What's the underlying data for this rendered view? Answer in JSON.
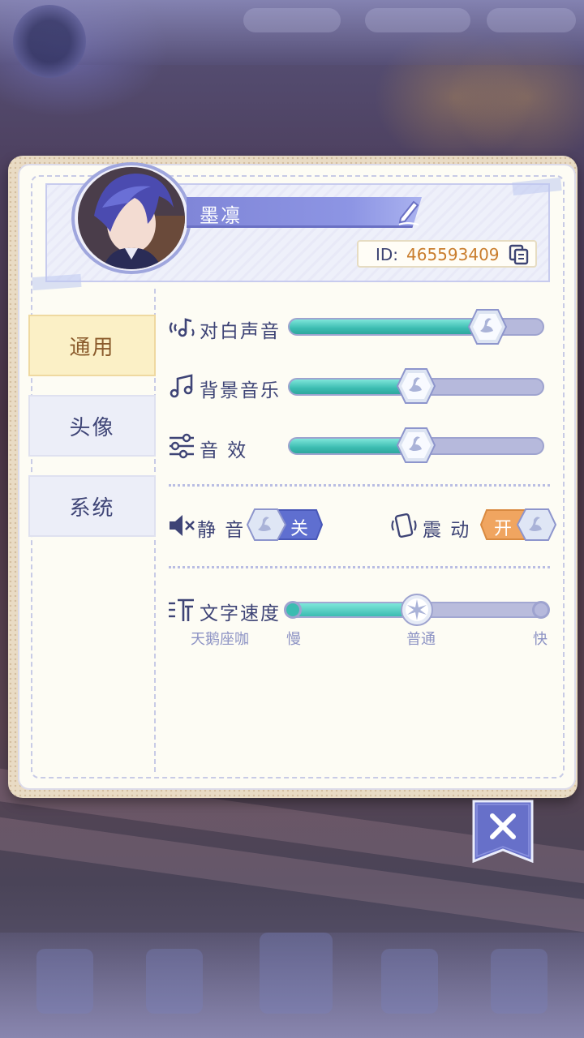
{
  "profile": {
    "name": "墨凛",
    "id_label": "ID:",
    "id_value": "465593409"
  },
  "tabs": [
    {
      "label": "通用",
      "active": true
    },
    {
      "label": "头像",
      "active": false
    },
    {
      "label": "系统",
      "active": false
    }
  ],
  "audio": {
    "dialogue": {
      "label": "对白声音",
      "level": 0.78
    },
    "music": {
      "label": "背景音乐",
      "level": 0.5
    },
    "sfx": {
      "label": "音 效",
      "level": 0.5
    }
  },
  "toggles": {
    "mute": {
      "label": "静 音",
      "state": "关"
    },
    "vibrate": {
      "label": "震 动",
      "state": "开"
    }
  },
  "text_speed": {
    "label": "文字速度",
    "preview": "天鹅座咖",
    "min_label": "慢",
    "mid_label": "普通",
    "max_label": "快",
    "level": 0.5
  },
  "colors": {
    "accent": "#8086d8",
    "fill": "#3cbcb1",
    "active_tab": "#fbf0c6",
    "toggle_on": "#f0a560",
    "toggle_off": "#5f6fd0"
  },
  "icons": {
    "edit": "pencil-icon",
    "copy": "copy-icon",
    "close": "close-icon"
  }
}
